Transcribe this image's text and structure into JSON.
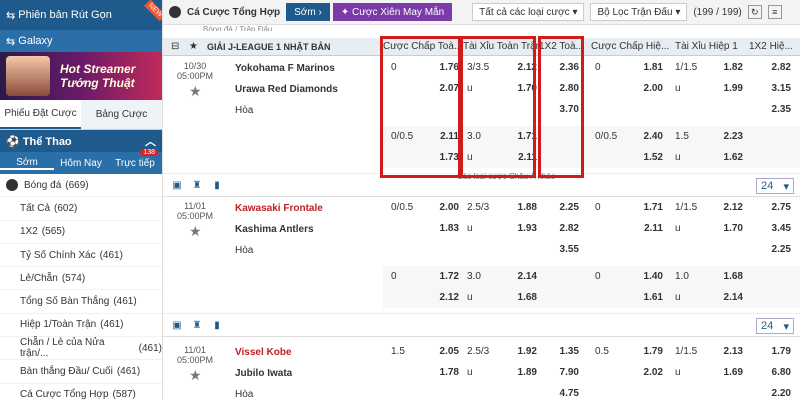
{
  "sidebar": {
    "top_label": "Phiên bản Rút Gọn",
    "new_badge": "NEW",
    "galaxy_label": "Galaxy",
    "banner_text": "Hot Streamer Tướng Thuật",
    "tab_bet_slip": "Phiếu Đặt Cược",
    "tab_board": "Bảng Cược",
    "sport_title": "Thể Thao",
    "sub_tabs": [
      "Sớm",
      "Hôm Nay",
      "Trực tiếp"
    ],
    "live_badge": "138",
    "list": [
      {
        "label": "Bóng đá",
        "count": "(669)"
      },
      {
        "label": "Tất Cả",
        "count": "(602)"
      },
      {
        "label": "1X2",
        "count": "(565)"
      },
      {
        "label": "Tỷ Số Chính Xác",
        "count": "(461)"
      },
      {
        "label": "Lẻ/Chẵn",
        "count": "(574)"
      },
      {
        "label": "Tổng Số Bàn Thắng",
        "count": "(461)"
      },
      {
        "label": "Hiệp 1/Toàn Trận",
        "count": "(461)"
      },
      {
        "label": "Chẵn / Lẻ của Nửa trận/...",
        "count": "(461)"
      },
      {
        "label": "Bàn thắng Đầu/ Cuối",
        "count": "(461)"
      },
      {
        "label": "Cá Cược Tổng Hợp",
        "count": "(587)"
      }
    ]
  },
  "topbar": {
    "title": "Cá Cược Tổng Hợp",
    "early_btn": "Sớm",
    "parlay_btn": "Cược Xiên May Mắn",
    "market_filter": "Tất cả các loại cược",
    "match_filter": "Bộ Lọc Trận Đấu",
    "count": "(199 / 199)"
  },
  "league": {
    "name": "GIẢI J-LEAGUE 1 NHẬT BẢN",
    "above": "Bóng đá / Trận Đấu"
  },
  "headers": [
    "Cược Chấp Toà...",
    "Tài Xỉu Toàn Trận",
    "1X2 Toà...",
    "Cược Chấp Hiệ...",
    "Tài Xỉu Hiệp 1",
    "1X2 Hiệ..."
  ],
  "footer_more": "Các loại cược Châu Á khác",
  "matches": [
    {
      "date": "10/30",
      "time": "05:00PM",
      "home": "Yokohama F Marinos",
      "away": "Urawa Red Diamonds",
      "draw": "Hòa",
      "home_red": false,
      "rows": [
        [
          "0",
          "1.76",
          "3/3.5",
          "2.12",
          "2.36",
          "0",
          "1.81",
          "1/1.5",
          "1.82",
          "2.82"
        ],
        [
          "",
          "2.07",
          "u",
          "1.70",
          "2.80",
          "",
          "2.00",
          "u",
          "1.99",
          "3.15"
        ],
        [
          "",
          "",
          "",
          "",
          "3.70",
          "",
          "",
          "",
          "",
          "2.35"
        ],
        [
          "0/0.5",
          "2.11",
          "3.0",
          "1.71",
          "",
          "0/0.5",
          "2.40",
          "1.5",
          "2.23",
          ""
        ],
        [
          "",
          "1.73",
          "u",
          "2.11",
          "",
          "",
          "1.52",
          "u",
          "1.62",
          ""
        ]
      ],
      "more_count": "24"
    },
    {
      "date": "11/01",
      "time": "05:00PM",
      "home": "Kawasaki Frontale",
      "away": "Kashima Antlers",
      "draw": "Hòa",
      "home_red": true,
      "rows": [
        [
          "0/0.5",
          "2.00",
          "2.5/3",
          "1.88",
          "2.25",
          "0",
          "1.71",
          "1/1.5",
          "2.12",
          "2.75"
        ],
        [
          "",
          "1.83",
          "u",
          "1.93",
          "2.82",
          "",
          "2.11",
          "u",
          "1.70",
          "3.45"
        ],
        [
          "",
          "",
          "",
          "",
          "3.55",
          "",
          "",
          "",
          "",
          "2.25"
        ],
        [
          "0",
          "1.72",
          "3.0",
          "2.14",
          "",
          "0",
          "1.40",
          "1.0",
          "1.68",
          ""
        ],
        [
          "",
          "2.12",
          "u",
          "1.68",
          "",
          "",
          "1.61",
          "u",
          "2.14",
          ""
        ]
      ],
      "more_count": "24"
    },
    {
      "date": "11/01",
      "time": "05:00PM",
      "home": "Vissel Kobe",
      "away": "Jubilo Iwata",
      "draw": "Hòa",
      "home_red": true,
      "rows": [
        [
          "1.5",
          "2.05",
          "2.5/3",
          "1.92",
          "1.35",
          "0.5",
          "1.79",
          "1/1.5",
          "2.13",
          "1.79"
        ],
        [
          "",
          "1.78",
          "u",
          "1.89",
          "7.90",
          "",
          "2.02",
          "u",
          "1.69",
          "6.80"
        ],
        [
          "",
          "",
          "",
          "",
          "4.75",
          "",
          "",
          "",
          "",
          "2.20"
        ]
      ],
      "more_count": ""
    }
  ],
  "colors": {
    "primary": "#1e5a8c",
    "highlight": "#d21a1a",
    "team_red": "#c02020",
    "parlay": "#7a3aa8"
  }
}
